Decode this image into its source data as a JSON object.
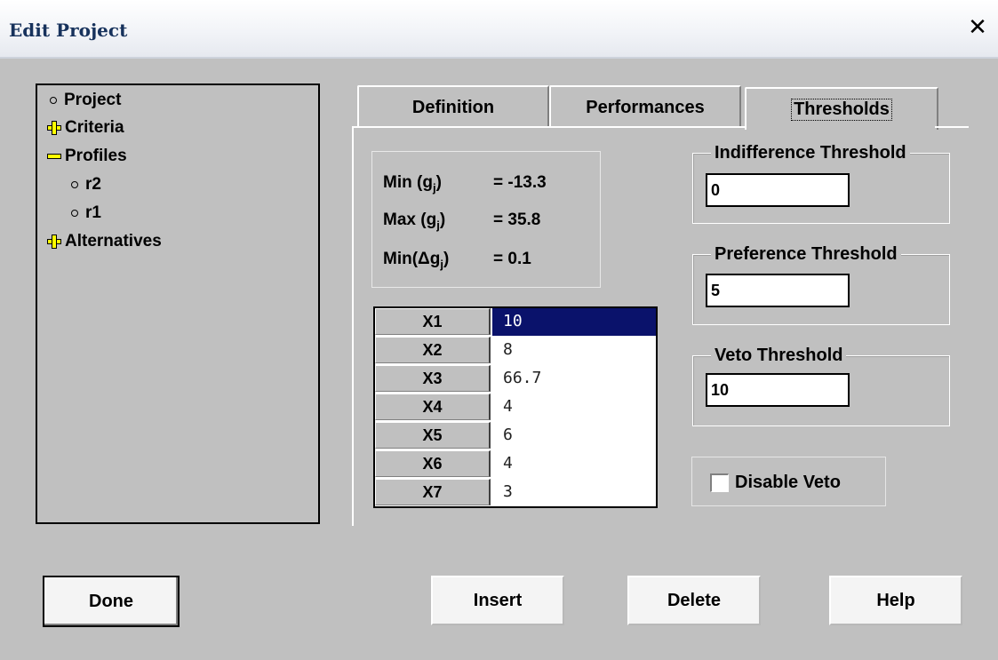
{
  "window": {
    "title": "Edit Project",
    "close_glyph": "✕"
  },
  "tree": {
    "items": [
      {
        "label": "Project",
        "kind": "leaf"
      },
      {
        "label": "Criteria",
        "kind": "collapsed"
      },
      {
        "label": "Profiles",
        "kind": "expanded"
      },
      {
        "label": "r2",
        "kind": "leaf"
      },
      {
        "label": "r1",
        "kind": "leaf"
      },
      {
        "label": "Alternatives",
        "kind": "collapsed"
      }
    ]
  },
  "tabs": [
    {
      "label": "Definition"
    },
    {
      "label": "Performances"
    },
    {
      "label": "Thresholds",
      "active": true
    }
  ],
  "stats": {
    "min": {
      "label_fn": "Min",
      "label_var": "g",
      "label_sub": "j",
      "value": "= -13.3"
    },
    "max": {
      "label_fn": "Max",
      "label_var": "g",
      "label_sub": "j",
      "value": "= 35.8"
    },
    "delta": {
      "label_fn": "Min",
      "label_var": "Δg",
      "label_sub": "j",
      "value": "= 0.1"
    }
  },
  "grid": {
    "rows": [
      {
        "header": "X1",
        "value": "10",
        "selected": true
      },
      {
        "header": "X2",
        "value": "8"
      },
      {
        "header": "X3",
        "value": "66.7"
      },
      {
        "header": "X4",
        "value": "4"
      },
      {
        "header": "X5",
        "value": "6"
      },
      {
        "header": "X6",
        "value": "4"
      },
      {
        "header": "X7",
        "value": "3"
      }
    ]
  },
  "thresholds": {
    "indifference": {
      "label": "Indifference Threshold",
      "value": "0"
    },
    "preference": {
      "label": "Preference Threshold",
      "value": "5"
    },
    "veto": {
      "label": "Veto Threshold",
      "value": "10"
    },
    "disable_veto": {
      "label": "Disable Veto",
      "checked": false
    }
  },
  "buttons": {
    "done": "Done",
    "insert": "Insert",
    "delete": "Delete",
    "help": "Help"
  },
  "colors": {
    "selection": "#0a126b",
    "face": "#c0c0c0",
    "expander": "#ffff00"
  }
}
